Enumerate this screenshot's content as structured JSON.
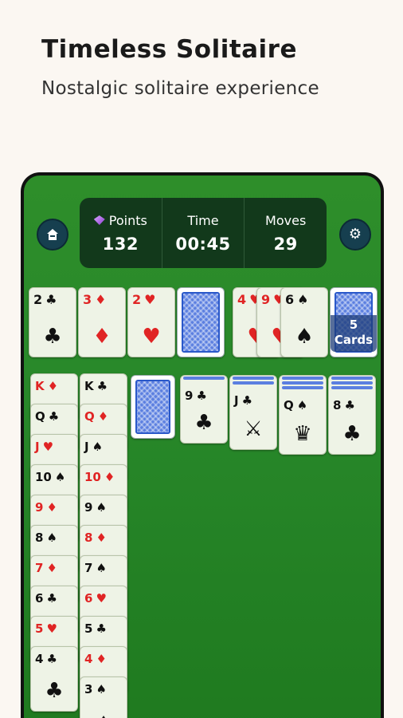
{
  "header": {
    "title": "Timeless Solitaire",
    "subtitle": "Nostalgic solitaire experience"
  },
  "stats": {
    "points_label": "Points",
    "points_value": "132",
    "time_label": "Time",
    "time_value": "00:45",
    "moves_label": "Moves",
    "moves_value": "29"
  },
  "buttons": {
    "home_icon": "home-icon",
    "settings_icon": "gear-icon"
  },
  "foundations": [
    {
      "rank": "2",
      "suit": "♣",
      "color": "black"
    },
    {
      "rank": "3",
      "suit": "♦",
      "color": "red"
    },
    {
      "rank": "2",
      "suit": "♥",
      "color": "red"
    }
  ],
  "waste": [
    {
      "rank": "4",
      "suit": "♥",
      "color": "red"
    },
    {
      "rank": "9",
      "suit": "♥",
      "color": "red"
    },
    {
      "rank": "6",
      "suit": "♠",
      "color": "black"
    }
  ],
  "stock": {
    "count": "5",
    "label": "Cards"
  },
  "tableau": {
    "col1": [
      {
        "rank": "K",
        "suit": "♦",
        "color": "red"
      },
      {
        "rank": "Q",
        "suit": "♣",
        "color": "black"
      },
      {
        "rank": "J",
        "suit": "♥",
        "color": "red"
      },
      {
        "rank": "10",
        "suit": "♠",
        "color": "black"
      },
      {
        "rank": "9",
        "suit": "♦",
        "color": "red"
      },
      {
        "rank": "8",
        "suit": "♠",
        "color": "black"
      },
      {
        "rank": "7",
        "suit": "♦",
        "color": "red"
      },
      {
        "rank": "6",
        "suit": "♣",
        "color": "black"
      },
      {
        "rank": "5",
        "suit": "♥",
        "color": "red"
      },
      {
        "rank": "4",
        "suit": "♣",
        "color": "black"
      }
    ],
    "col2": [
      {
        "rank": "K",
        "suit": "♣",
        "color": "black"
      },
      {
        "rank": "Q",
        "suit": "♦",
        "color": "red"
      },
      {
        "rank": "J",
        "suit": "♠",
        "color": "black"
      },
      {
        "rank": "10",
        "suit": "♦",
        "color": "red"
      },
      {
        "rank": "9",
        "suit": "♠",
        "color": "black"
      },
      {
        "rank": "8",
        "suit": "♦",
        "color": "red"
      },
      {
        "rank": "7",
        "suit": "♠",
        "color": "black"
      },
      {
        "rank": "6",
        "suit": "♥",
        "color": "red"
      },
      {
        "rank": "5",
        "suit": "♣",
        "color": "black"
      },
      {
        "rank": "4",
        "suit": "♦",
        "color": "red"
      },
      {
        "rank": "3",
        "suit": "♠",
        "color": "black"
      }
    ],
    "col4": {
      "rank": "9",
      "suit": "♣",
      "color": "black"
    },
    "col5": {
      "rank": "J",
      "suit": "♣",
      "color": "black",
      "face": "⚔"
    },
    "col6": {
      "rank": "Q",
      "suit": "♠",
      "color": "black",
      "face": "♛"
    },
    "col7": {
      "rank": "8",
      "suit": "♣",
      "color": "black"
    }
  },
  "colors": {
    "table_green": "#28882a",
    "red_suit": "#e02424",
    "card_face": "#eef3e6",
    "card_back": "#5b7fe0",
    "stats_panel": "#12391b"
  }
}
